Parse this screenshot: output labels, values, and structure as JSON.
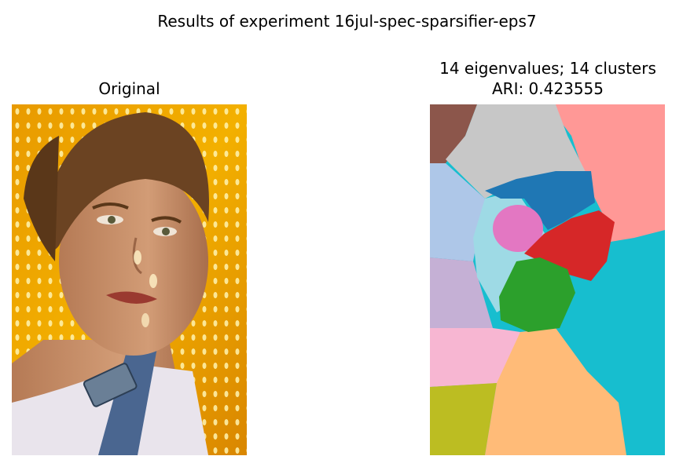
{
  "figure": {
    "suptitle": "Results of experiment 16jul-spec-sparsifier-eps7"
  },
  "left_panel": {
    "title": "Original"
  },
  "right_panel": {
    "title_line1": "14 eigenvalues; 14 clusters",
    "title_line2": "ARI: 0.423555"
  },
  "colors": {
    "background_yellow": "#e8a000",
    "background_orange": "#f5b800",
    "hair": "#6b4322",
    "skin": "#c98f6a",
    "lips": "#9a3a30",
    "shirt": "#e8e4ea",
    "overalls": "#4a6690",
    "cluster_brown": "#8c564b",
    "cluster_gray": "#c7c7c7",
    "cluster_salmon": "#ff9896",
    "cluster_lightblue": "#aec7e8",
    "cluster_blue": "#1f77b4",
    "cluster_pink": "#e377c2",
    "cluster_red": "#d62728",
    "cluster_lightcyan": "#9edae5",
    "cluster_lavender": "#c5b0d5",
    "cluster_green": "#2ca02c",
    "cluster_cyan": "#17becf",
    "cluster_lightpink": "#f7b6d2",
    "cluster_olive": "#bcbd22",
    "cluster_peach": "#ffbb78"
  }
}
